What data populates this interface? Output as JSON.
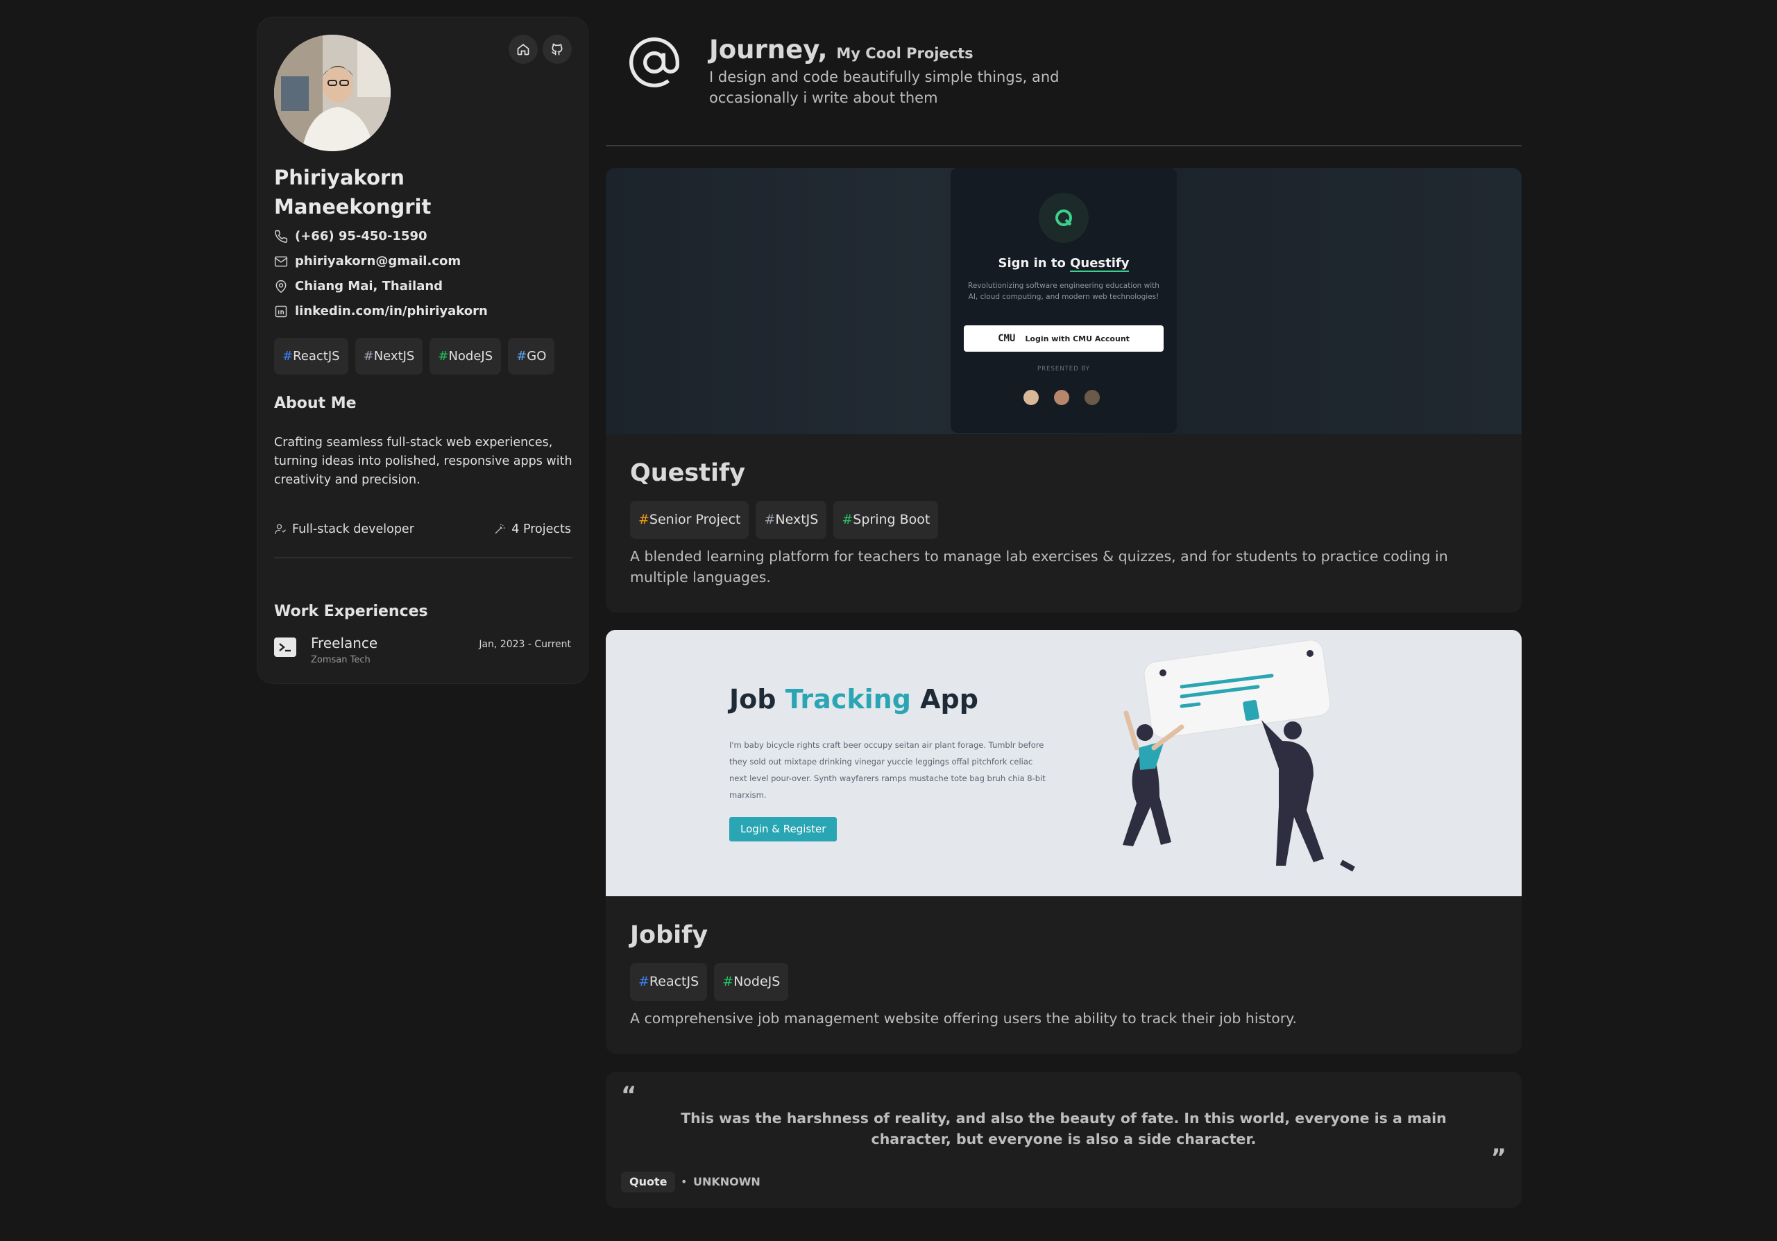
{
  "profile": {
    "name_line1": "Phiriyakorn",
    "name_line2": "Maneekongrit",
    "phone": "(+66) 95-450-1590",
    "email": "phiriyakorn@gmail.com",
    "location": "Chiang Mai, Thailand",
    "linkedin": "linkedin.com/in/phiriyakorn",
    "skills": [
      {
        "hash": "#",
        "label": "ReactJS",
        "color": "#3b82f6"
      },
      {
        "hash": "#",
        "label": "NextJS",
        "color": "#9ca3af"
      },
      {
        "hash": "#",
        "label": "NodeJS",
        "color": "#22c55e"
      },
      {
        "hash": "#",
        "label": "GO",
        "color": "#60a5fa"
      }
    ],
    "about_heading": "About Me",
    "about_text": "Crafting seamless full-stack web experiences, turning ideas into polished, responsive apps with creativity and precision.",
    "role": "Full-stack developer",
    "projects_count": "4 Projects",
    "work_heading": "Work Experiences",
    "work": {
      "title": "Freelance",
      "company": "Zomsan Tech",
      "period": "Jan, 2023 - Current"
    }
  },
  "header": {
    "title": "Journey,",
    "subtitle": "My Cool Projects",
    "tagline": "I design and code beautifully simple things, and occasionally i write about them"
  },
  "projects": [
    {
      "name": "Questify",
      "tags": [
        {
          "hash": "#",
          "label": "Senior Project",
          "color": "#f59e0b"
        },
        {
          "hash": "#",
          "label": "NextJS",
          "color": "#9ca3af"
        },
        {
          "hash": "#",
          "label": "Spring Boot",
          "color": "#22c55e"
        }
      ],
      "description": "A blended learning platform for teachers to manage lab exercises & quizzes, and for students to practice coding in multiple languages.",
      "preview": {
        "title_pre": "Sign in to ",
        "title_brand": "Questify",
        "text": "Revolutionizing software engineering education with AI, cloud computing, and modern web technologies!",
        "button_logo": "CMU",
        "button": "Login with CMU Account",
        "presented": "PRESENTED BY"
      }
    },
    {
      "name": "Jobify",
      "tags": [
        {
          "hash": "#",
          "label": "ReactJS",
          "color": "#3b82f6"
        },
        {
          "hash": "#",
          "label": "NodeJS",
          "color": "#22c55e"
        }
      ],
      "description": "A comprehensive job management website offering users the ability to track their job history.",
      "preview": {
        "heading_a": "Job ",
        "heading_b": "Tracking",
        "heading_c": " App",
        "text": "I'm baby bicycle rights craft beer occupy seitan air plant forage. Tumblr before they sold out mixtape drinking vinegar yuccie leggings offal pitchfork celiac next level pour-over. Synth wayfarers ramps mustache tote bag bruh chia 8-bit marxism.",
        "button": "Login & Register",
        "accent": "#2aa5b3"
      }
    }
  ],
  "quote": {
    "text": "This was the harshness of reality, and also the beauty of fate. In this world, everyone is a main character, but everyone is also a side character.",
    "badge": "Quote",
    "author": "UNKNOWN",
    "open_mark": "“",
    "close_mark": "”",
    "separator": "•"
  }
}
